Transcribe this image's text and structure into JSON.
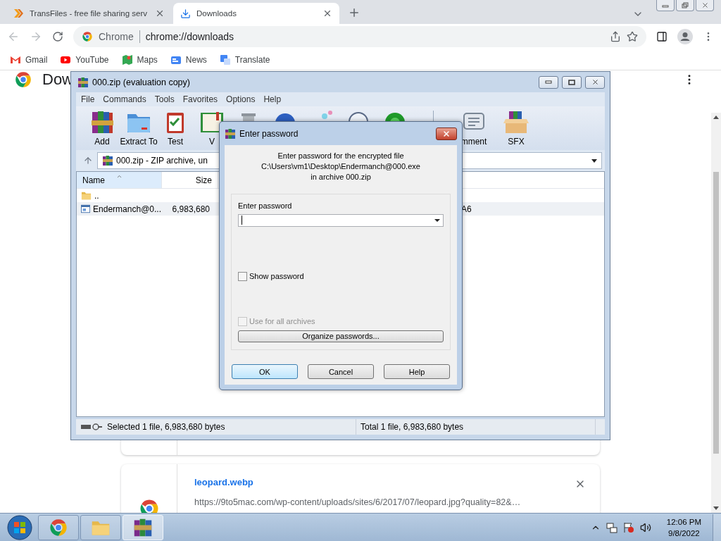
{
  "browser": {
    "tabs": [
      {
        "title": "TransFiles - free file sharing serv",
        "selected": false
      },
      {
        "title": "Downloads",
        "selected": true
      }
    ],
    "omnibox": {
      "site": "Chrome",
      "url": "chrome://downloads"
    },
    "bookmarks": [
      "Gmail",
      "YouTube",
      "Maps",
      "News",
      "Translate"
    ]
  },
  "page": {
    "heading": "Dow",
    "downloads": [
      {
        "file": "leopard.webp",
        "url": "https://9to5mac.com/wp-content/uploads/sites/6/2017/07/leopard.jpg?quality=82&…"
      }
    ]
  },
  "archiver": {
    "title": "000.zip (evaluation copy)",
    "menu": [
      "File",
      "Commands",
      "Tools",
      "Favorites",
      "Options",
      "Help"
    ],
    "toolbar": [
      "Add",
      "Extract To",
      "Test",
      "V",
      "mment",
      "SFX"
    ],
    "address": "000.zip - ZIP archive, un",
    "columns": [
      {
        "label": "Name",
        "sorted": true
      },
      {
        "label": "Size",
        "sorted": false
      }
    ],
    "rows": [
      {
        "kind": "folder",
        "name": ".."
      },
      {
        "kind": "file",
        "name": "Endermanch@0...",
        "size": "6,983,680",
        "column_3": "A6"
      }
    ],
    "status": [
      "Selected 1 file, 6,983,680 bytes",
      "Total 1 file, 6,983,680 bytes"
    ]
  },
  "dialog": {
    "title": "Enter password",
    "message": [
      "Enter password for the encrypted file",
      "C:\\Users\\vm1\\Desktop\\Endermanch@000.exe",
      "in archive 000.zip"
    ],
    "field_label": "Enter password",
    "checks": [
      {
        "label": "Show password",
        "checked": false,
        "disabled": false
      },
      {
        "label": "Use for all archives",
        "checked": false,
        "disabled": true
      }
    ],
    "organize": "Organize passwords...",
    "buttons": [
      {
        "label": "OK",
        "default": true
      },
      {
        "label": "Cancel",
        "default": false
      },
      {
        "label": "Help",
        "default": false
      }
    ]
  },
  "taskbar": {
    "apps": [
      {
        "kind": "chrome",
        "selected": false
      },
      {
        "kind": "folder",
        "selected": false
      },
      {
        "kind": "archiver",
        "selected": true
      }
    ],
    "time": "12:06 PM",
    "date": "9/8/2022"
  }
}
